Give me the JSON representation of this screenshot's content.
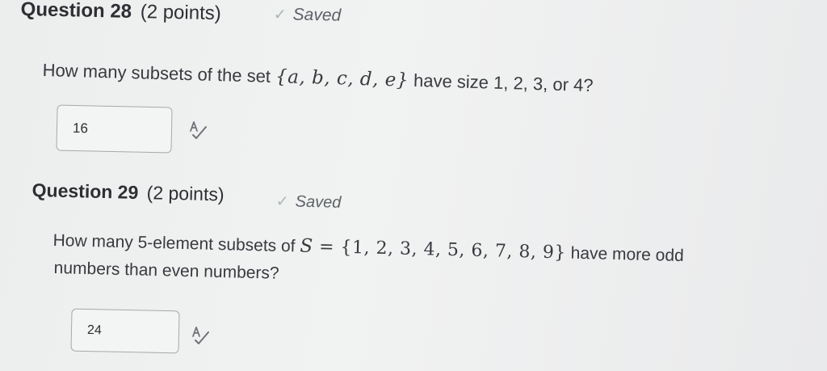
{
  "questions": [
    {
      "number_label": "Question 28",
      "points_label": "(2 points)",
      "status": "Saved",
      "prompt_lead": "How many subsets of the set ",
      "prompt_set": "{a, b, c, d, e}",
      "prompt_tail": " have size 1, 2, 3, or 4?",
      "answer": "16"
    },
    {
      "number_label": "Question 29",
      "points_label": "(2 points)",
      "status": "Saved",
      "prompt_lead": "How many 5-element subsets of ",
      "prompt_var": "S",
      "prompt_eq": " = ",
      "prompt_set": "{1, 2, 3, 4, 5, 6, 7, 8, 9}",
      "prompt_tail": " have more odd",
      "prompt_line2": "numbers than even numbers?",
      "answer": "24"
    }
  ],
  "icons": {
    "saved": "check-icon",
    "spellcheck": "spellcheck-icon"
  }
}
